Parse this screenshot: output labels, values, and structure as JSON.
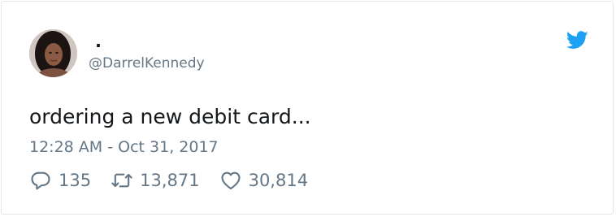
{
  "user": {
    "display_name": ".",
    "handle": "@DarrelKennedy",
    "avatar": "profile-photo"
  },
  "tweet": {
    "text": "ordering a new debit card...",
    "timestamp": "12:28 AM - Oct 31, 2017"
  },
  "actions": {
    "replies": "135",
    "retweets": "13,871",
    "likes": "30,814"
  },
  "colors": {
    "text": "#14171a",
    "secondary": "#657786",
    "twitter_blue": "#1da1f2",
    "border": "#e1e8ed"
  }
}
